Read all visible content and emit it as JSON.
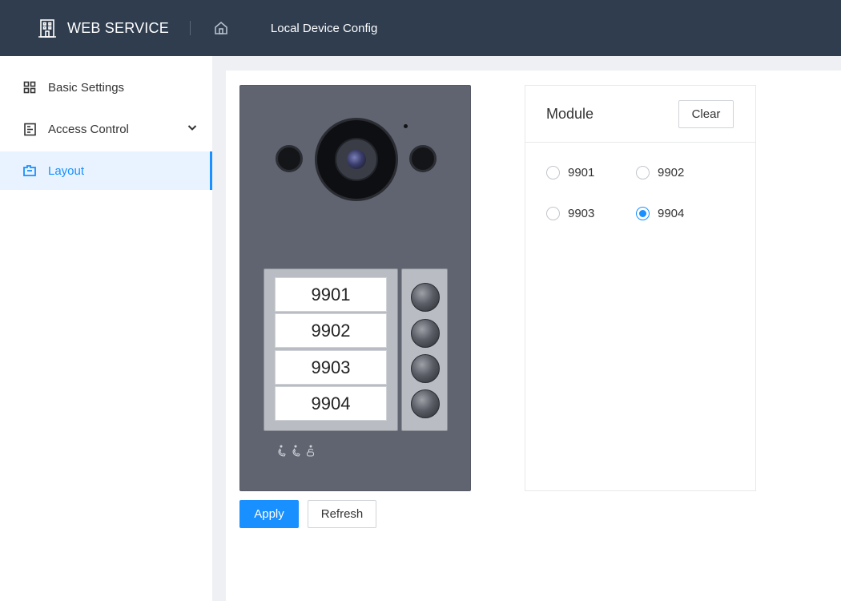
{
  "header": {
    "brand": "WEB SERVICE",
    "nav_title": "Local Device Config",
    "brand_icon": "building-icon",
    "home_icon": "home-icon"
  },
  "sidebar": {
    "items": [
      {
        "label": "Basic Settings",
        "icon": "grid-icon",
        "active": false
      },
      {
        "label": "Access Control",
        "icon": "door-list-icon",
        "active": false,
        "expandable": true
      },
      {
        "label": "Layout",
        "icon": "layout-icon",
        "active": true
      }
    ]
  },
  "device": {
    "labels": [
      "9901",
      "9902",
      "9903",
      "9904"
    ]
  },
  "actions": {
    "apply": "Apply",
    "refresh": "Refresh"
  },
  "module": {
    "title": "Module",
    "clear": "Clear",
    "options": [
      {
        "label": "9901",
        "checked": false
      },
      {
        "label": "9902",
        "checked": false
      },
      {
        "label": "9903",
        "checked": false
      },
      {
        "label": "9904",
        "checked": true
      }
    ]
  },
  "colors": {
    "accent": "#1890ff",
    "topbar": "#2f3d4f",
    "device_body": "#5f6470"
  }
}
